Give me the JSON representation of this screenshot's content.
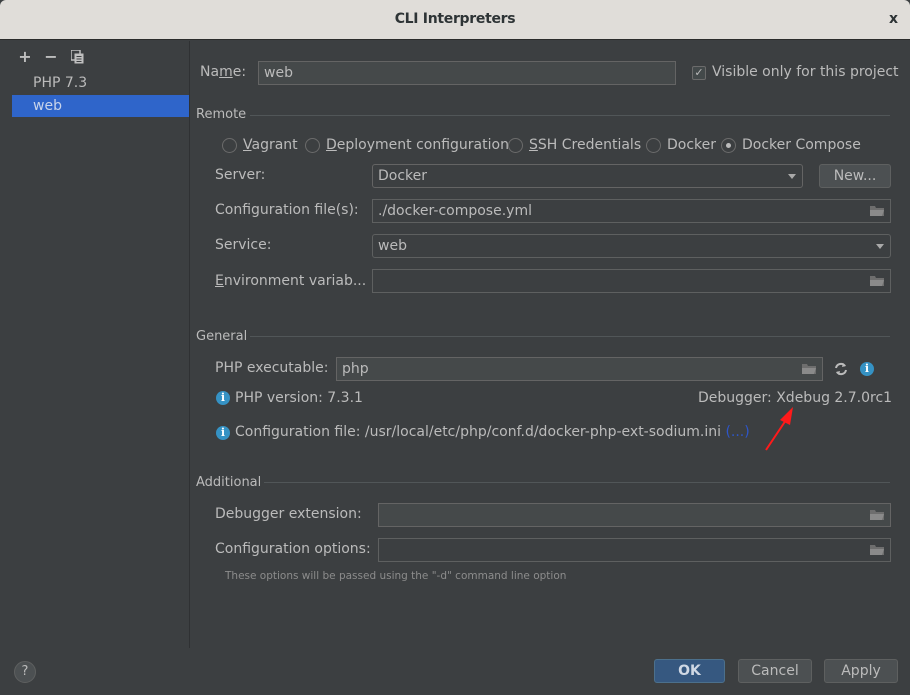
{
  "window": {
    "title": "CLI Interpreters",
    "close_label": "x"
  },
  "sidebar": {
    "toolbar": {
      "add": "+",
      "remove": "−",
      "copy": "⧉"
    },
    "items": [
      {
        "label": "PHP 7.3",
        "selected": false
      },
      {
        "label": "web",
        "selected": true
      }
    ]
  },
  "name_row": {
    "label_pre": "Na",
    "label_mnemonic": "m",
    "label_post": "e:",
    "value": "web",
    "visible_only_label": "Visible only for this project",
    "visible_only_checked": true
  },
  "remote": {
    "section_label": "Remote",
    "options": [
      {
        "mnemonic": "V",
        "rest": "agrant",
        "selected": false
      },
      {
        "mnemonic": "D",
        "rest": "eployment configuration",
        "selected": false
      },
      {
        "mnemonic": "S",
        "rest": "SH Credentials",
        "selected": false
      },
      {
        "mnemonic": "",
        "rest": "Docker",
        "selected": false
      },
      {
        "mnemonic": "",
        "rest": "Docker Compose",
        "selected": true
      }
    ],
    "server_label": "Server:",
    "server_value": "Docker",
    "new_button": "New...",
    "config_label": "Configuration file(s):",
    "config_value": "./docker-compose.yml",
    "service_label": "Service:",
    "service_value": "web",
    "env_label_mnemonic": "E",
    "env_label_rest": "nvironment variab...",
    "env_value": ""
  },
  "general": {
    "section_label": "General",
    "php_exec_label": "PHP executable:",
    "php_exec_value": "php",
    "php_version": "PHP version: 7.3.1",
    "debugger": "Debugger: Xdebug 2.7.0rc1",
    "config_file": "Configuration file: /usr/local/etc/php/conf.d/docker-php-ext-sodium.ini",
    "config_more_link": "(...)"
  },
  "additional": {
    "section_label": "Additional",
    "debugger_ext_label": "Debugger extension:",
    "debugger_ext_value": "",
    "config_options_label": "Configuration options:",
    "config_options_value": "",
    "hint": "These options will be passed using the \"-d\" command line option"
  },
  "footer": {
    "help": "?",
    "ok": "OK",
    "cancel": "Cancel",
    "apply": "Apply"
  },
  "annotation": {
    "arrow_color": "#ff1a1a"
  }
}
